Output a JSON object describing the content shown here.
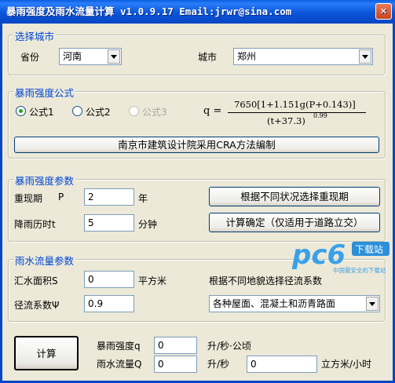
{
  "window": {
    "title": "暴雨强度及雨水流量计算 v1.0.9.17 Email:jrwr@sina.com",
    "close_icon": "close-icon"
  },
  "city": {
    "legend": "选择城市",
    "province_label": "省份",
    "province_value": "河南",
    "city_label": "城市",
    "city_value": "郑州"
  },
  "formula": {
    "legend": "暴雨强度公式",
    "options": [
      "公式1",
      "公式2",
      "公式3"
    ],
    "selected": "公式1",
    "q_label": "q =",
    "numerator": "7650[1+1.151g(P+0.143)]",
    "denominator": "(t+37.3)",
    "exponent": "0.99",
    "source_button": "南京市建筑设计院采用CRA方法编制"
  },
  "params": {
    "legend": "暴雨强度参数",
    "period_label": "重现期",
    "period_symbol": "P",
    "period_value": "2",
    "period_unit": "年",
    "period_button": "根据不同状况选择重现期",
    "duration_label": "降雨历时t",
    "duration_value": "5",
    "duration_unit": "分钟",
    "duration_button": "计算确定（仅适用于道路立交）"
  },
  "flow": {
    "legend": "雨水流量参数",
    "area_label": "汇水面积S",
    "area_value": "0",
    "area_unit": "平方米",
    "coef_hint": "根据不同地貌选择径流系数",
    "coef_label": "径流系数Ψ",
    "coef_value": "0.9",
    "coef_select": "各种屋面、混凝土和沥青路面"
  },
  "result": {
    "calc_button": "计算",
    "intensity_label": "暴雨强度q",
    "intensity_value": "0",
    "intensity_unit": "升/秒·公顷",
    "flow_label": "雨水流量Q",
    "flow_value": "0",
    "flow_unit": "升/秒",
    "flow_value2": "0",
    "flow_unit2": "立方米/小时"
  },
  "watermark": {
    "logo": "pc6",
    "badge": "下载站",
    "tagline": "中国最安全的下载站"
  }
}
